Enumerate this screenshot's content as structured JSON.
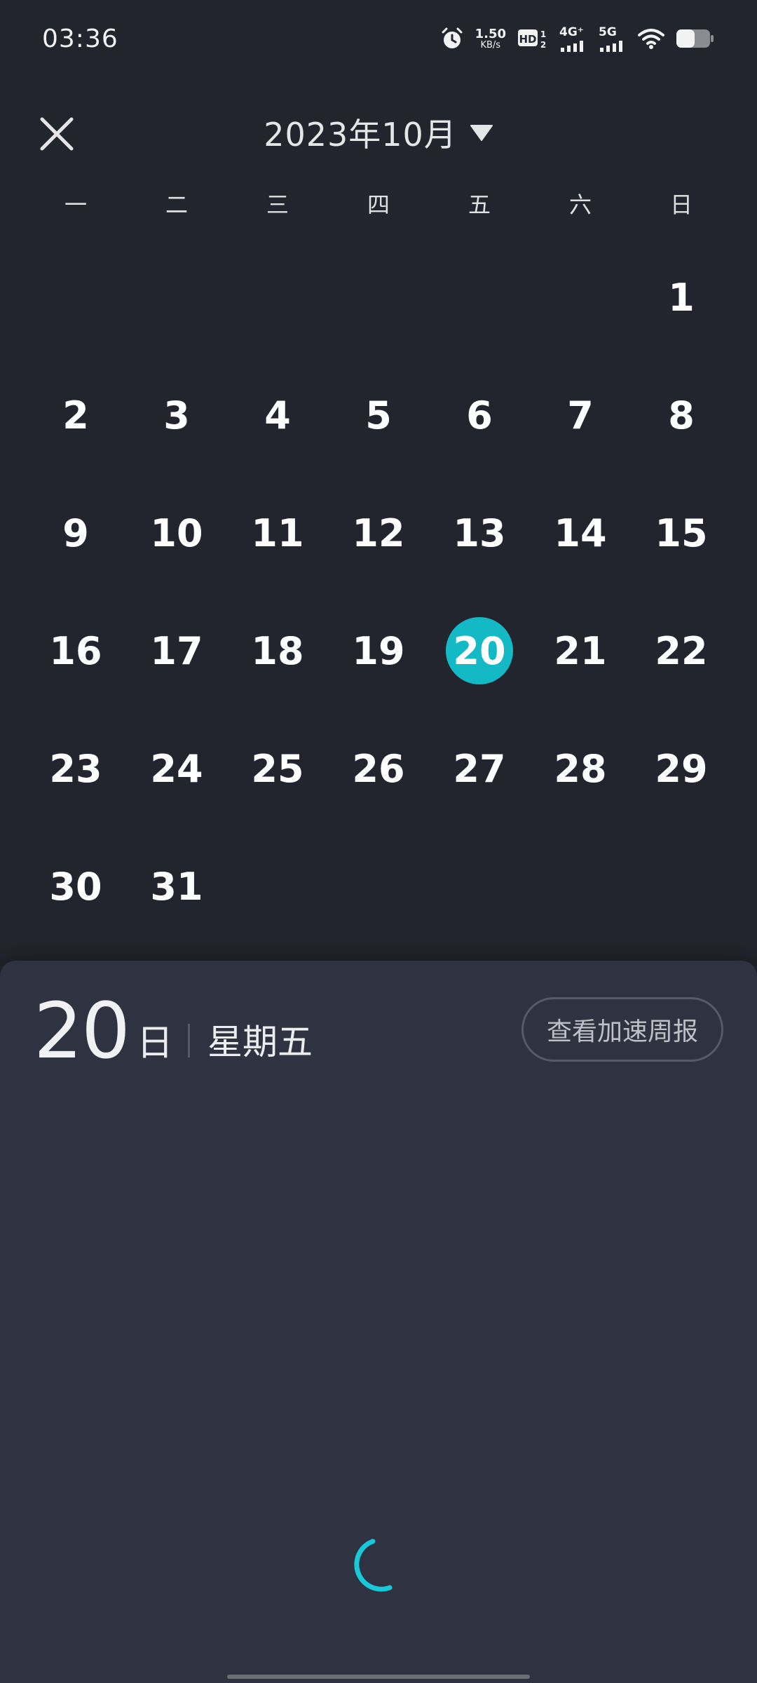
{
  "status_bar": {
    "time": "03:36",
    "net_speed_value": "1.50",
    "net_speed_unit": "KB/s",
    "hd_label": "HD",
    "sim1_label": "4G⁺",
    "sim2_label": "5G"
  },
  "header": {
    "month_title": "2023年10月"
  },
  "weekdays": [
    "一",
    "二",
    "三",
    "四",
    "五",
    "六",
    "日"
  ],
  "calendar": {
    "leading_blanks": 6,
    "days": [
      "1",
      "2",
      "3",
      "4",
      "5",
      "6",
      "7",
      "8",
      "9",
      "10",
      "11",
      "12",
      "13",
      "14",
      "15",
      "16",
      "17",
      "18",
      "19",
      "20",
      "21",
      "22",
      "23",
      "24",
      "25",
      "26",
      "27",
      "28",
      "29",
      "30",
      "31"
    ],
    "selected_day": "20",
    "accent_color": "#13b9c4"
  },
  "detail": {
    "day_number": "20",
    "day_unit": "日",
    "weekday_name": "星期五",
    "report_button": "查看加速周报"
  },
  "colors": {
    "background": "#23252e",
    "sheet": "#2f3240",
    "spinner": "#17c9d9"
  }
}
